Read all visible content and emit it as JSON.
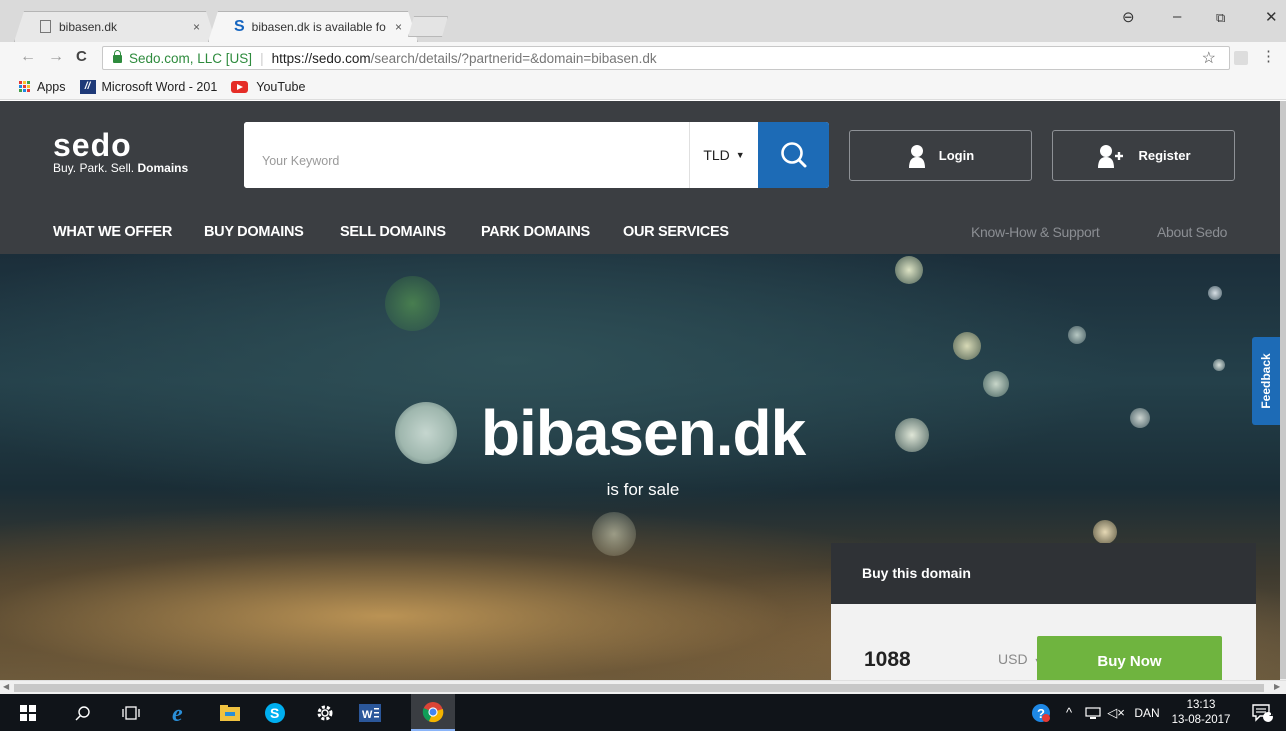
{
  "browser": {
    "tabs": [
      {
        "title": "bibasen.dk",
        "close": "×",
        "active": false
      },
      {
        "title": "bibasen.dk is available fo",
        "close": "×",
        "active": true
      }
    ],
    "window_controls": {
      "profile": "⊖",
      "minimize": "–",
      "restore": "⧉",
      "close": "✕"
    },
    "nav": {
      "back": "←",
      "forward": "→",
      "reload": "C"
    },
    "address": {
      "org": "Sedo.com, LLC [US]",
      "separator": "|",
      "url_host": "https://sedo.com",
      "url_rest": "/search/details/?partnerid=&domain=bibasen.dk"
    },
    "bookmark_star": "☆",
    "menu": "⋮",
    "bookmarks": [
      {
        "label": "Apps",
        "icon": "apps-grid-icon"
      },
      {
        "label": "Microsoft Word - 201",
        "icon": "word-doc-icon"
      },
      {
        "label": "YouTube",
        "icon": "youtube-icon"
      }
    ]
  },
  "site": {
    "logo": {
      "word": "sedo",
      "tagline_prefix": "Buy. Park. Sell.",
      "tagline_bold": "Domains"
    },
    "search": {
      "placeholder": "Your Keyword",
      "tld_label": "TLD",
      "tld_caret": "▼"
    },
    "account": {
      "login": "Login",
      "register": "Register"
    },
    "nav": [
      {
        "label": "WHAT WE OFFER"
      },
      {
        "label": "BUY DOMAINS"
      },
      {
        "label": "SELL DOMAINS"
      },
      {
        "label": "PARK DOMAINS"
      },
      {
        "label": "OUR SERVICES"
      }
    ],
    "nav_secondary": [
      {
        "label": "Know-How & Support"
      },
      {
        "label": "About Sedo"
      }
    ],
    "hero": {
      "domain": "bibasen.dk",
      "status": "is for sale"
    },
    "feedback": "Feedback",
    "buy_panel": {
      "heading": "Buy this domain",
      "price": "1088",
      "currency": "USD",
      "currency_caret": "▼",
      "button": "Buy Now"
    }
  },
  "taskbar": {
    "tray": {
      "language": "DAN",
      "time": "13:13",
      "date": "13-08-2017",
      "notification_count": "1"
    }
  },
  "colors": {
    "header_bg": "#3b3e42",
    "search_blue": "#1d6bb6",
    "buy_green": "#6fb43f",
    "secure_green": "#2e8b3d"
  }
}
